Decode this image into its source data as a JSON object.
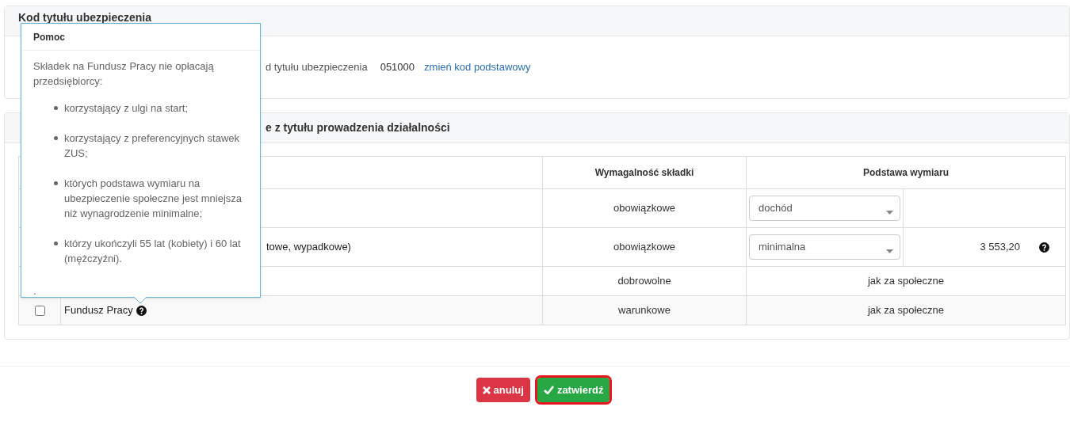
{
  "section_code": {
    "title": "Kod tytułu ubezpieczenia",
    "label": "d tytułu ubezpieczenia",
    "value": "051000",
    "link": "zmień kod podstawowy"
  },
  "section_contrib": {
    "title_end": "e z tytułu prowadzenia działalności",
    "columns": [
      "Wymagalność składki",
      "Podstawa wymiaru"
    ],
    "rows": [
      {
        "kind": "select",
        "name": "",
        "requirement": "obowiązkowe",
        "basis": "dochód",
        "amount": "",
        "help": false
      },
      {
        "kind": "select",
        "name": "towe, wypadkowe)",
        "requirement": "obowiązkowe",
        "basis": "minimalna",
        "amount": "3 553,20",
        "help": true
      },
      {
        "kind": "text",
        "name": "",
        "requirement": "dobrowolne",
        "basis": "jak za społeczne",
        "help": false
      },
      {
        "kind": "checkbox",
        "name": "Fundusz Pracy",
        "checked": false,
        "help": true,
        "requirement": "warunkowe",
        "basis": "jak za społeczne"
      }
    ]
  },
  "popover": {
    "title": "Pomoc",
    "intro": "Składek na Fundusz Pracy nie opłacają przedsiębiorcy:",
    "items": [
      "korzystający z ulgi na start;",
      "korzystający z preferencyjnych stawek ZUS;",
      "których podstawa wymiaru na ubezpieczenie społeczne jest mniejsza niż wynagrodzenie minimalne;",
      "którzy ukończyli 55 lat (kobiety) i 60 lat (mężczyźni)."
    ],
    "footer": "."
  },
  "buttons": [
    {
      "kind": "cancel",
      "label": "anuluj",
      "focused": false
    },
    {
      "kind": "confirm",
      "label": "zatwierdź",
      "focused": true
    }
  ]
}
